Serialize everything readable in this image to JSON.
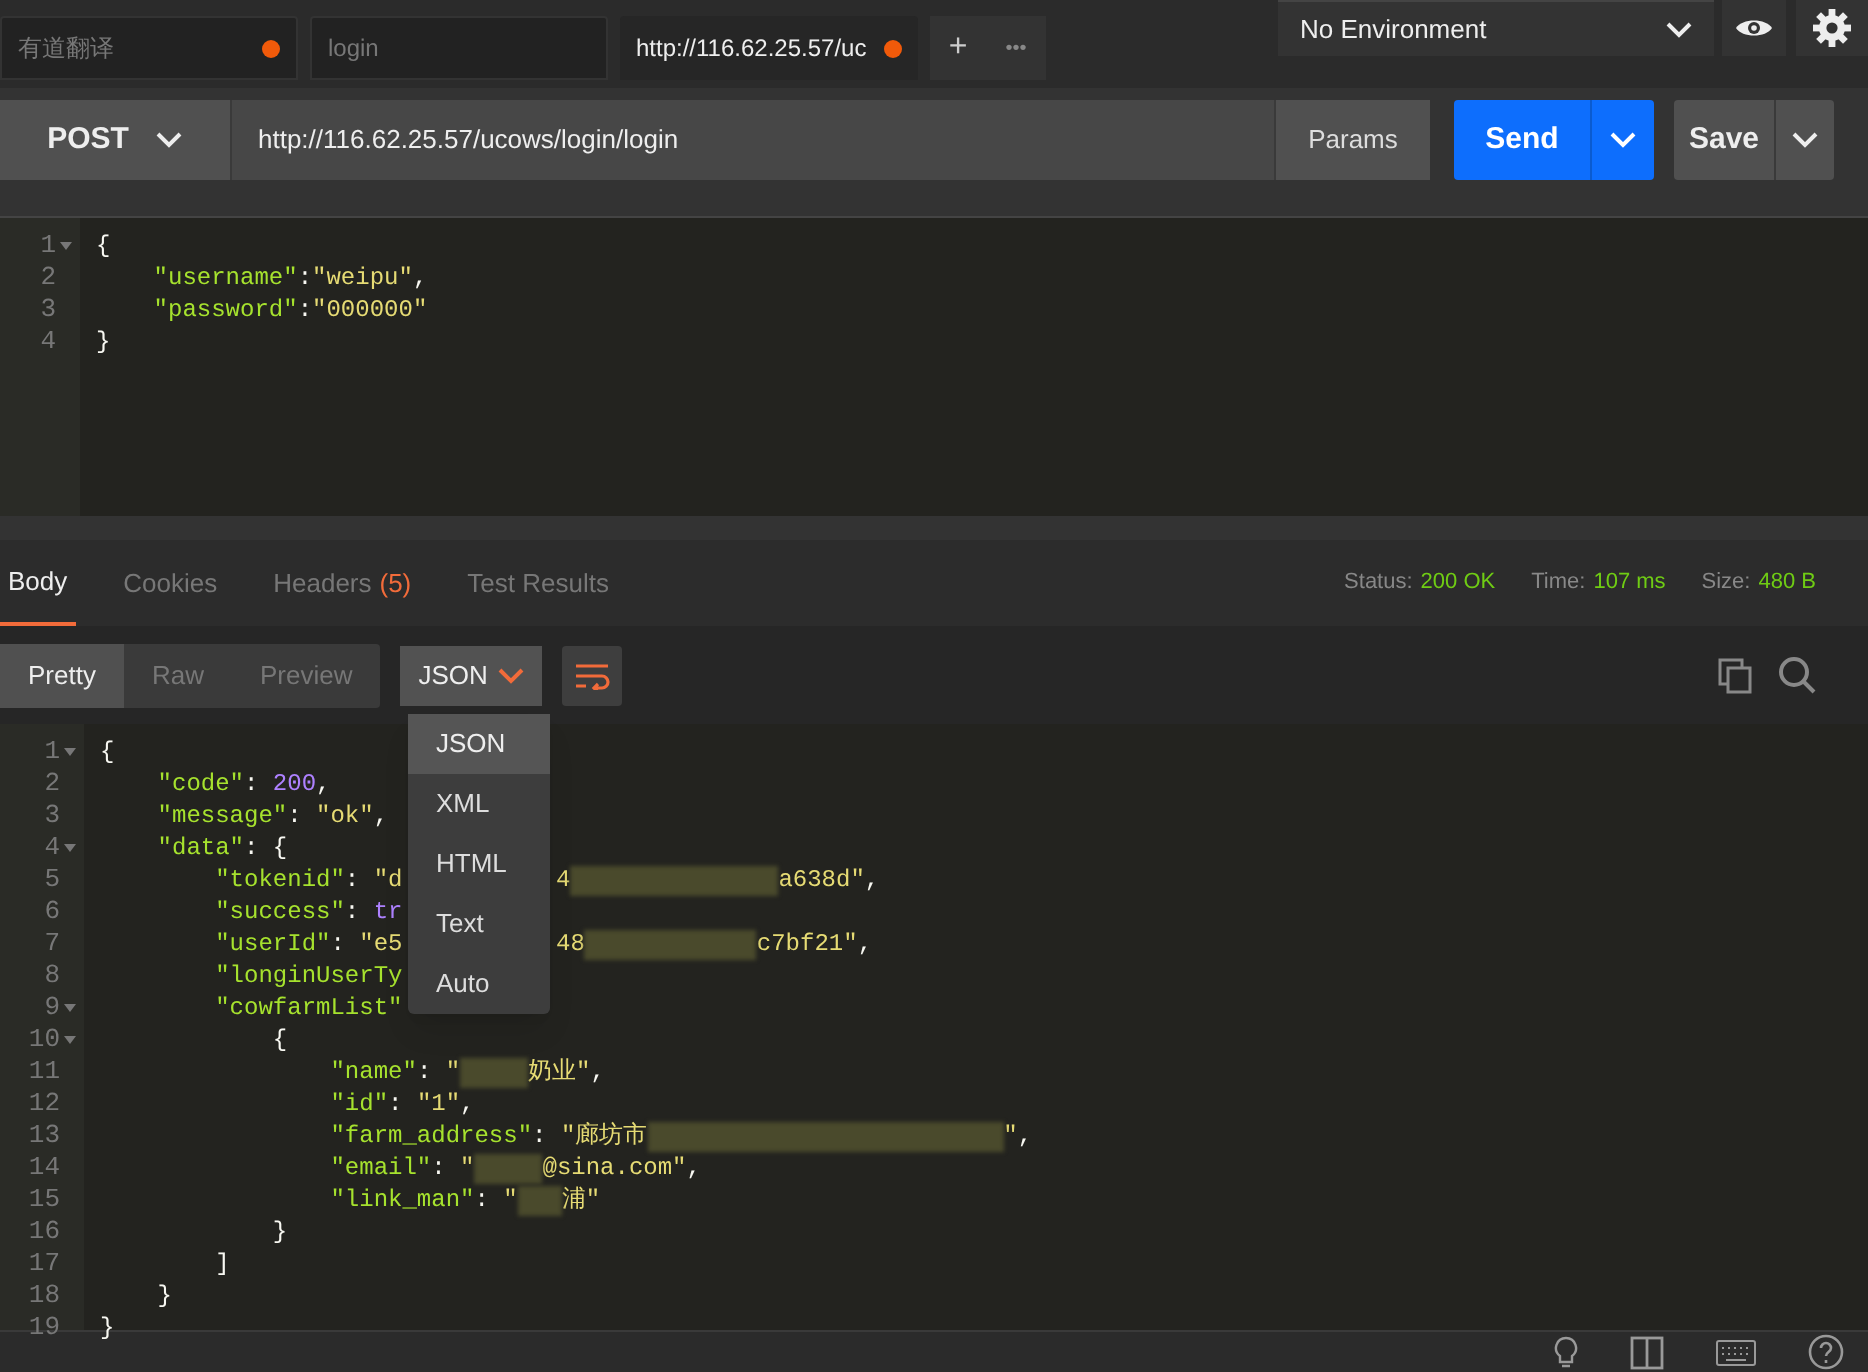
{
  "tabs": [
    {
      "label": "有道翻译",
      "unsaved": true,
      "selected": false
    },
    {
      "label": "login",
      "unsaved": false,
      "selected": false
    },
    {
      "label": "http://116.62.25.57/uc",
      "unsaved": true,
      "selected": true
    }
  ],
  "new_tab": "+",
  "more_tabs": "•••",
  "environment": {
    "value": "No Environment"
  },
  "request": {
    "method": "POST",
    "url": "http://116.62.25.57/ucows/login/login",
    "params": "Params",
    "send": "Send",
    "save": "Save"
  },
  "request_body": [
    {
      "number": "1",
      "foldable": true,
      "tokens": [
        {
          "kind": "punct",
          "text": "{"
        }
      ]
    },
    {
      "number": "2",
      "foldable": false,
      "tokens": [
        {
          "kind": "key",
          "text": "    \"username\""
        },
        {
          "kind": "punct",
          "text": ":"
        },
        {
          "kind": "string",
          "text": "\"weipu\""
        },
        {
          "kind": "punct",
          "text": ","
        }
      ]
    },
    {
      "number": "3",
      "foldable": false,
      "tokens": [
        {
          "kind": "key",
          "text": "    \"password\""
        },
        {
          "kind": "punct",
          "text": ":"
        },
        {
          "kind": "string",
          "text": "\"000000\""
        }
      ]
    },
    {
      "number": "4",
      "foldable": false,
      "tokens": [
        {
          "kind": "punct",
          "text": "}"
        }
      ]
    }
  ],
  "response_tabs": [
    {
      "label": "Body",
      "selected": true
    },
    {
      "label": "Cookies",
      "selected": false
    },
    {
      "label": "Headers",
      "count": "(5)",
      "selected": false
    },
    {
      "label": "Test Results",
      "selected": false
    }
  ],
  "response_meta": [
    {
      "label": "Status:",
      "value": "200 OK"
    },
    {
      "label": "Time:",
      "value": "107 ms"
    },
    {
      "label": "Size:",
      "value": "480 B"
    }
  ],
  "view_modes": [
    {
      "label": "Pretty",
      "selected": true
    },
    {
      "label": "Raw",
      "selected": false
    },
    {
      "label": "Preview",
      "selected": false
    }
  ],
  "format": {
    "value": "JSON",
    "expanded": true,
    "options": [
      {
        "label": "JSON",
        "selected": true
      },
      {
        "label": "XML",
        "selected": false
      },
      {
        "label": "HTML",
        "selected": false
      },
      {
        "label": "Text",
        "selected": false
      },
      {
        "label": "Auto",
        "selected": false
      }
    ]
  },
  "response_body": [
    {
      "number": "1",
      "foldable": true,
      "tokens": [
        {
          "kind": "punct",
          "text": "{"
        }
      ]
    },
    {
      "number": "2",
      "foldable": false,
      "tokens": [
        {
          "kind": "key",
          "text": "    \"code\""
        },
        {
          "kind": "punct",
          "text": ": "
        },
        {
          "kind": "number",
          "text": "200"
        },
        {
          "kind": "punct",
          "text": ","
        }
      ]
    },
    {
      "number": "3",
      "foldable": false,
      "tokens": [
        {
          "kind": "key",
          "text": "    \"message\""
        },
        {
          "kind": "punct",
          "text": ": "
        },
        {
          "kind": "string",
          "text": "\"ok\""
        },
        {
          "kind": "punct",
          "text": ","
        }
      ]
    },
    {
      "number": "4",
      "foldable": true,
      "tokens": [
        {
          "kind": "key",
          "text": "    \"data\""
        },
        {
          "kind": "punct",
          "text": ": {"
        }
      ]
    },
    {
      "number": "5",
      "foldable": false,
      "tokens": [
        {
          "kind": "key",
          "text": "        \"tokenid\""
        },
        {
          "kind": "punct",
          "text": ": "
        },
        {
          "kind": "string",
          "text": "\"d"
        },
        {
          "kind": "covered"
        },
        {
          "kind": "string",
          "text": "4"
        },
        {
          "kind": "redacted"
        },
        {
          "kind": "string",
          "text": "a638d\""
        },
        {
          "kind": "punct",
          "text": ","
        }
      ]
    },
    {
      "number": "6",
      "foldable": false,
      "tokens": [
        {
          "kind": "key",
          "text": "        \"success\""
        },
        {
          "kind": "punct",
          "text": ": "
        },
        {
          "kind": "bool",
          "text": "tr"
        }
      ]
    },
    {
      "number": "7",
      "foldable": false,
      "tokens": [
        {
          "kind": "key",
          "text": "        \"userId\""
        },
        {
          "kind": "punct",
          "text": ": "
        },
        {
          "kind": "string",
          "text": "\"e5"
        },
        {
          "kind": "covered"
        },
        {
          "kind": "string",
          "text": "48"
        },
        {
          "kind": "redacted"
        },
        {
          "kind": "string",
          "text": "c7bf21\""
        },
        {
          "kind": "punct",
          "text": ","
        }
      ]
    },
    {
      "number": "8",
      "foldable": false,
      "tokens": [
        {
          "kind": "key",
          "text": "        \"longinUserTy"
        }
      ]
    },
    {
      "number": "9",
      "foldable": true,
      "tokens": [
        {
          "kind": "key",
          "text": "        \"cowfarmList\""
        }
      ]
    },
    {
      "number": "10",
      "foldable": true,
      "tokens": [
        {
          "kind": "punct",
          "text": "            {"
        }
      ]
    },
    {
      "number": "11",
      "foldable": false,
      "tokens": [
        {
          "kind": "key",
          "text": "                \"name\""
        },
        {
          "kind": "punct",
          "text": ": "
        },
        {
          "kind": "string",
          "text": "\""
        },
        {
          "kind": "redacted"
        },
        {
          "kind": "string",
          "text": "奶业\""
        },
        {
          "kind": "punct",
          "text": ","
        }
      ]
    },
    {
      "number": "12",
      "foldable": false,
      "tokens": [
        {
          "kind": "key",
          "text": "                \"id\""
        },
        {
          "kind": "punct",
          "text": ": "
        },
        {
          "kind": "string",
          "text": "\"1\""
        },
        {
          "kind": "punct",
          "text": ","
        }
      ]
    },
    {
      "number": "13",
      "foldable": false,
      "tokens": [
        {
          "kind": "key",
          "text": "                \"farm_address\""
        },
        {
          "kind": "punct",
          "text": ": "
        },
        {
          "kind": "string",
          "text": "\"廊坊市"
        },
        {
          "kind": "redacted"
        },
        {
          "kind": "string",
          "text": "\""
        },
        {
          "kind": "punct",
          "text": ","
        }
      ]
    },
    {
      "number": "14",
      "foldable": false,
      "tokens": [
        {
          "kind": "key",
          "text": "                \"email\""
        },
        {
          "kind": "punct",
          "text": ": "
        },
        {
          "kind": "string",
          "text": "\""
        },
        {
          "kind": "redacted"
        },
        {
          "kind": "string",
          "text": "@sina.com\""
        },
        {
          "kind": "punct",
          "text": ","
        }
      ]
    },
    {
      "number": "15",
      "foldable": false,
      "tokens": [
        {
          "kind": "key",
          "text": "                \"link_man\""
        },
        {
          "kind": "punct",
          "text": ": "
        },
        {
          "kind": "string",
          "text": "\""
        },
        {
          "kind": "redacted"
        },
        {
          "kind": "string",
          "text": "浦\""
        }
      ]
    },
    {
      "number": "16",
      "foldable": false,
      "tokens": [
        {
          "kind": "punct",
          "text": "            }"
        }
      ]
    },
    {
      "number": "17",
      "foldable": false,
      "tokens": [
        {
          "kind": "punct",
          "text": "        ]"
        }
      ]
    },
    {
      "number": "18",
      "foldable": false,
      "tokens": [
        {
          "kind": "punct",
          "text": "    }"
        }
      ]
    },
    {
      "number": "19",
      "foldable": false,
      "tokens": [
        {
          "kind": "punct",
          "text": "}"
        }
      ]
    }
  ]
}
